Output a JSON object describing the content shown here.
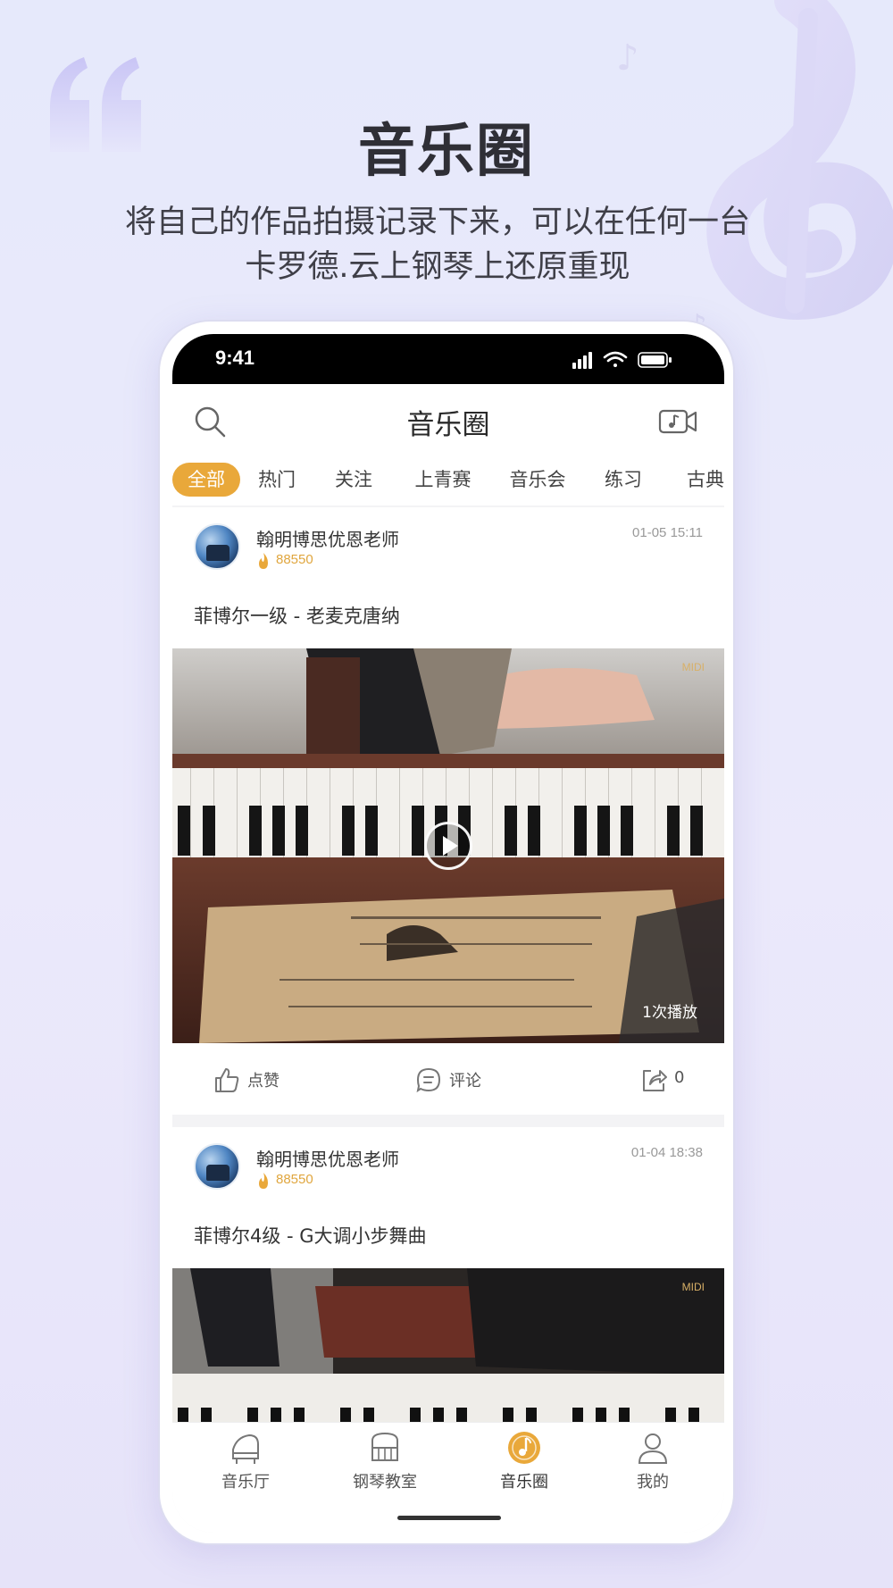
{
  "hero": {
    "title": "音乐圈",
    "subtitle_line1": "将自己的作品拍摄记录下来，可以在任何一台",
    "subtitle_line2": "卡罗德.云上钢琴上还原重现"
  },
  "status_bar": {
    "time": "9:41"
  },
  "header": {
    "title": "音乐圈",
    "search_icon": "search-icon",
    "camera_icon": "video-music-icon"
  },
  "tabs": [
    {
      "label": "全部",
      "active": true
    },
    {
      "label": "热门"
    },
    {
      "label": "关注"
    },
    {
      "label": "上青赛"
    },
    {
      "label": "音乐会"
    },
    {
      "label": "练习"
    },
    {
      "label": "古典"
    }
  ],
  "posts": [
    {
      "author": "翰明博思优恩老师",
      "heat": "88550",
      "time": "01-05 15:11",
      "title": "菲博尔一级 - 老麦克唐纳",
      "badge": "MIDI",
      "play_count": "1次播放",
      "actions": {
        "like": "点赞",
        "comment": "评论",
        "share_count": "0"
      }
    },
    {
      "author": "翰明博思优恩老师",
      "heat": "88550",
      "time": "01-04 18:38",
      "title": "菲博尔4级 - G大调小步舞曲",
      "badge": "MIDI"
    }
  ],
  "bottom_nav": [
    {
      "label": "音乐厅",
      "icon": "piano-hall-icon"
    },
    {
      "label": "钢琴教室",
      "icon": "piano-classroom-icon"
    },
    {
      "label": "音乐圈",
      "icon": "music-circle-icon",
      "active": true
    },
    {
      "label": "我的",
      "icon": "profile-icon"
    }
  ],
  "colors": {
    "accent": "#e9a83a",
    "background": "#e6e9fb",
    "heat": "#e0a63e"
  }
}
